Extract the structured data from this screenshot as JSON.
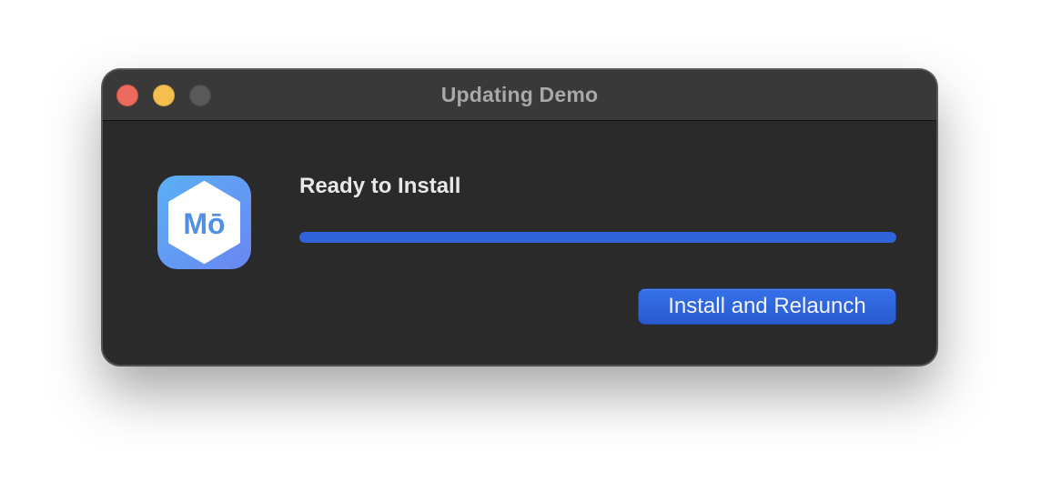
{
  "window": {
    "title": "Updating Demo",
    "controls": [
      "close",
      "minimize",
      "zoom"
    ]
  },
  "app_icon": {
    "icon": "hexagon-logo-icon",
    "logo_text": "Mō",
    "colors": {
      "gradient_start": "#5ab0f5",
      "gradient_end": "#6a86f2",
      "hexagon": "#ffffff",
      "letters": "#4f8fe6"
    }
  },
  "update": {
    "status": "Ready to Install",
    "progress": 1.0,
    "button_label": "Install and Relaunch"
  },
  "colors": {
    "window_bg": "#2b2a2a",
    "titlebar_bg": "#3a3939",
    "accent": "#2f63d7",
    "close": "#ec6a5e",
    "minimize": "#f4bf4f",
    "zoom_inactive": "#5a5959"
  }
}
